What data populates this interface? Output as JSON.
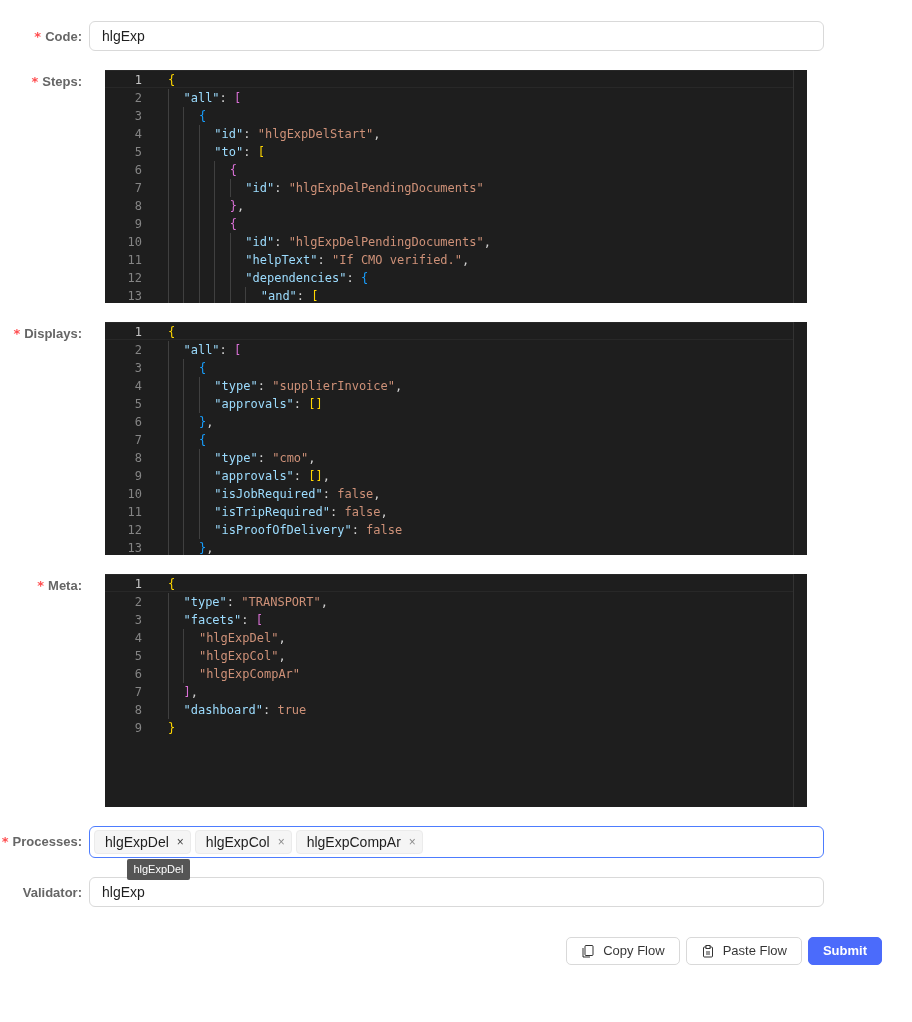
{
  "fields": [
    {
      "kind": "text",
      "label": "Code:",
      "required_mark": "*",
      "value": "hlgExp"
    },
    {
      "kind": "code",
      "label": "Steps:",
      "required_mark": "*",
      "lines": [
        {
          "number": "1",
          "text": "{",
          "current": true
        },
        {
          "number": "2",
          "text": "  \"all\": [",
          "current": false
        },
        {
          "number": "3",
          "text": "    {",
          "current": false
        },
        {
          "number": "4",
          "text": "      \"id\": \"hlgExpDelStart\",",
          "current": false
        },
        {
          "number": "5",
          "text": "      \"to\": [",
          "current": false
        },
        {
          "number": "6",
          "text": "        {",
          "current": false
        },
        {
          "number": "7",
          "text": "          \"id\": \"hlgExpDelPendingDocuments\"",
          "current": false
        },
        {
          "number": "8",
          "text": "        },",
          "current": false
        },
        {
          "number": "9",
          "text": "        {",
          "current": false
        },
        {
          "number": "10",
          "text": "          \"id\": \"hlgExpDelPendingDocuments\",",
          "current": false
        },
        {
          "number": "11",
          "text": "          \"helpText\": \"If CMO verified.\",",
          "current": false
        },
        {
          "number": "12",
          "text": "          \"dependencies\": {",
          "current": false
        },
        {
          "number": "13",
          "text": "            \"and\": [",
          "current": false
        }
      ]
    },
    {
      "kind": "code",
      "label": "Displays:",
      "required_mark": "*",
      "lines": [
        {
          "number": "1",
          "text": "{",
          "current": true
        },
        {
          "number": "2",
          "text": "  \"all\": [",
          "current": false
        },
        {
          "number": "3",
          "text": "    {",
          "current": false
        },
        {
          "number": "4",
          "text": "      \"type\": \"supplierInvoice\",",
          "current": false
        },
        {
          "number": "5",
          "text": "      \"approvals\": []",
          "current": false
        },
        {
          "number": "6",
          "text": "    },",
          "current": false
        },
        {
          "number": "7",
          "text": "    {",
          "current": false
        },
        {
          "number": "8",
          "text": "      \"type\": \"cmo\",",
          "current": false
        },
        {
          "number": "9",
          "text": "      \"approvals\": [],",
          "current": false
        },
        {
          "number": "10",
          "text": "      \"isJobRequired\": false,",
          "current": false
        },
        {
          "number": "11",
          "text": "      \"isTripRequired\": false,",
          "current": false
        },
        {
          "number": "12",
          "text": "      \"isProofOfDelivery\": false",
          "current": false
        },
        {
          "number": "13",
          "text": "    },",
          "current": false
        }
      ]
    },
    {
      "kind": "code",
      "label": "Meta:",
      "required_mark": "*",
      "lines": [
        {
          "number": "1",
          "text": "{",
          "current": true
        },
        {
          "number": "2",
          "text": "  \"type\": \"TRANSPORT\",",
          "current": false
        },
        {
          "number": "3",
          "text": "  \"facets\": [",
          "current": false
        },
        {
          "number": "4",
          "text": "    \"hlgExpDel\",",
          "current": false
        },
        {
          "number": "5",
          "text": "    \"hlgExpCol\",",
          "current": false
        },
        {
          "number": "6",
          "text": "    \"hlgExpCompAr\"",
          "current": false
        },
        {
          "number": "7",
          "text": "  ],",
          "current": false
        },
        {
          "number": "8",
          "text": "  \"dashboard\": true",
          "current": false
        },
        {
          "number": "9",
          "text": "}",
          "current": false
        }
      ]
    },
    {
      "kind": "tags",
      "label": "Processes:",
      "required_mark": "*",
      "focused": true,
      "tooltip": "hlgExpDel",
      "tags": [
        {
          "label": "hlgExpDel",
          "remove": "×",
          "hovered": true
        },
        {
          "label": "hlgExpCol",
          "remove": "×",
          "hovered": false
        },
        {
          "label": "hlgExpCompAr",
          "remove": "×",
          "hovered": false
        }
      ]
    },
    {
      "kind": "text",
      "label": "Validator:",
      "value": "hlgExp"
    }
  ],
  "buttons": [
    {
      "label": "Copy Flow",
      "kind": "copy"
    },
    {
      "label": "Paste Flow",
      "kind": "paste"
    },
    {
      "label": "Submit",
      "kind": "primary"
    }
  ]
}
